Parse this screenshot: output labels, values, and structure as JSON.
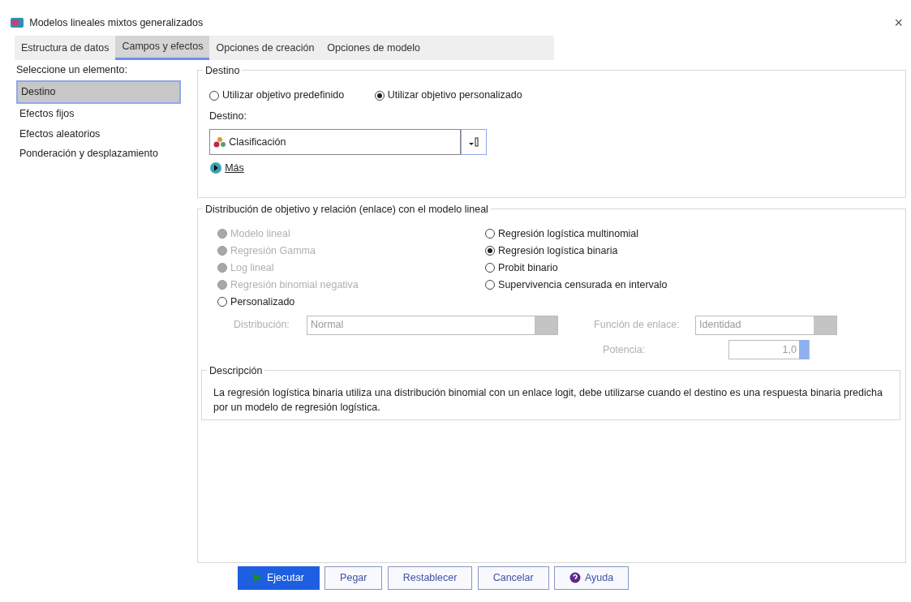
{
  "window": {
    "title": "Modelos lineales mixtos generalizados",
    "close": "×"
  },
  "tabs": [
    {
      "label": "Estructura de datos",
      "selected": false
    },
    {
      "label": "Campos y efectos",
      "selected": true
    },
    {
      "label": "Opciones de creación",
      "selected": false
    },
    {
      "label": "Opciones de modelo",
      "selected": false
    }
  ],
  "sidebar": {
    "label": "Seleccione un elemento:",
    "items": [
      {
        "label": "Destino",
        "selected": true
      },
      {
        "label": "Efectos fijos",
        "selected": false
      },
      {
        "label": "Efectos aleatorios",
        "selected": false
      },
      {
        "label": "Ponderación y desplazamiento",
        "selected": false
      }
    ]
  },
  "target_group": {
    "title": "Destino",
    "options": [
      {
        "label": "Utilizar objetivo predefinido",
        "selected": false
      },
      {
        "label": "Utilizar objetivo personalizado",
        "selected": true
      }
    ],
    "field_label": "Destino:",
    "field_value": "Clasificación",
    "more": "Más"
  },
  "distribution_group": {
    "title": "Distribución de objetivo y relación (enlace) con el modelo lineal",
    "left_options": [
      {
        "label": "Modelo lineal",
        "selected": false,
        "disabled": true
      },
      {
        "label": "Regresión Gamma",
        "selected": false,
        "disabled": true
      },
      {
        "label": "Log lineal",
        "selected": false,
        "disabled": true
      },
      {
        "label": "Regresión binomial negativa",
        "selected": false,
        "disabled": true
      },
      {
        "label": "Personalizado",
        "selected": false,
        "disabled": false
      }
    ],
    "right_options": [
      {
        "label": "Regresión logística multinomial",
        "selected": false,
        "disabled": false
      },
      {
        "label": "Regresión logística binaria",
        "selected": true,
        "disabled": false
      },
      {
        "label": "Probit binario",
        "selected": false,
        "disabled": false
      },
      {
        "label": "Supervivencia censurada en intervalo",
        "selected": false,
        "disabled": false
      }
    ],
    "distribution": {
      "label": "Distribución:",
      "value": "Normal",
      "disabled": true
    },
    "link_function": {
      "label": "Función de enlace:",
      "value": "Identidad",
      "disabled": true
    },
    "power": {
      "label": "Potencia:",
      "value": "1,0",
      "disabled": true
    },
    "description": {
      "title": "Descripción",
      "text": "La regresión logística binaria utiliza una distribución binomial con un enlace logit, debe utilizarse cuando el destino es una respuesta binaria predicha por un modelo de regresión logística."
    }
  },
  "buttons": [
    {
      "label": "Ejecutar",
      "kind": "run"
    },
    {
      "label": "Pegar",
      "kind": "plain"
    },
    {
      "label": "Restablecer",
      "kind": "plain"
    },
    {
      "label": "Cancelar",
      "kind": "plain"
    },
    {
      "label": "Ayuda",
      "kind": "help"
    }
  ]
}
